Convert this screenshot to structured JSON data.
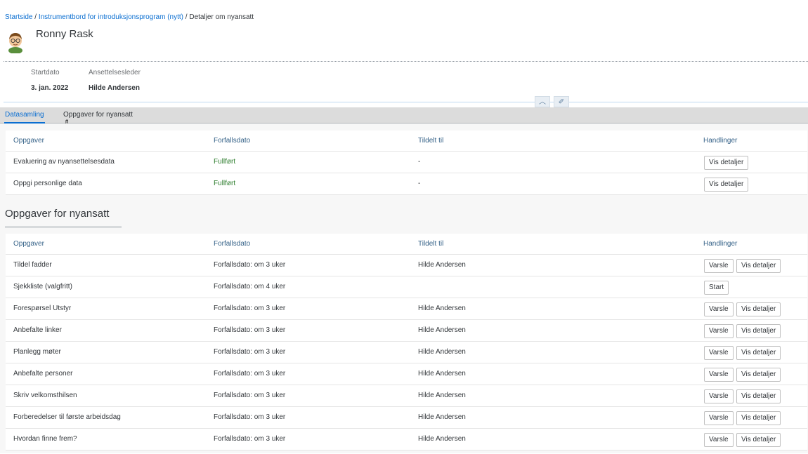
{
  "breadcrumb": {
    "home": "Startside",
    "sep1": " / ",
    "dashboard": "Instrumentbord for introduksjonsprogram (nytt)",
    "sep2": " / ",
    "current": "Detaljer om nyansatt"
  },
  "employee": {
    "name": "Ronny Rask"
  },
  "meta": {
    "start_label": "Startdato",
    "start_value": "3. jan. 2022",
    "manager_label": "Ansettelsesleder",
    "manager_value": "Hilde Andersen"
  },
  "controls": {
    "collapse_glyph": "︿",
    "pin_glyph": "✐"
  },
  "tabs": [
    {
      "label": "Datasamling"
    },
    {
      "label": "Oppgaver for nyansatt"
    }
  ],
  "datasamling": {
    "headers": [
      "Oppgaver",
      "Forfallsdato",
      "Tildelt til",
      "Handlinger"
    ],
    "rows": [
      {
        "task": "Evaluering av nyansettelsesdata",
        "due": "Fullført",
        "assigned": "-",
        "details": "Vis detaljer"
      },
      {
        "task": "Oppgi personlige data",
        "due": "Fullført",
        "assigned": "-",
        "details": "Vis detaljer"
      }
    ]
  },
  "nyansatt": {
    "title": "Oppgaver for nyansatt",
    "headers": [
      "Oppgaver",
      "Forfallsdato",
      "Tildelt til",
      "Handlinger"
    ],
    "rows": [
      {
        "task": "Tildel fadder",
        "due": "Forfallsdato: om 3 uker",
        "assigned": "Hilde Andersen",
        "notify": "Varsle",
        "details": "Vis detaljer"
      },
      {
        "task": "Sjekkliste (valgfritt)",
        "due": "Forfallsdato: om 4 uker",
        "assigned": "",
        "start": "Start"
      },
      {
        "task": "Forespørsel Utstyr",
        "due": "Forfallsdato: om 3 uker",
        "assigned": "Hilde Andersen",
        "notify": "Varsle",
        "details": "Vis detaljer"
      },
      {
        "task": "Anbefalte linker",
        "due": "Forfallsdato: om 3 uker",
        "assigned": "Hilde Andersen",
        "notify": "Varsle",
        "details": "Vis detaljer"
      },
      {
        "task": "Planlegg møter",
        "due": "Forfallsdato: om 3 uker",
        "assigned": "Hilde Andersen",
        "notify": "Varsle",
        "details": "Vis detaljer"
      },
      {
        "task": "Anbefalte personer",
        "due": "Forfallsdato: om 3 uker",
        "assigned": "Hilde Andersen",
        "notify": "Varsle",
        "details": "Vis detaljer"
      },
      {
        "task": "Skriv velkomsthilsen",
        "due": "Forfallsdato: om 3 uker",
        "assigned": "Hilde Andersen",
        "notify": "Varsle",
        "details": "Vis detaljer"
      },
      {
        "task": "Forberedelser til første arbeidsdag",
        "due": "Forfallsdato: om 3 uker",
        "assigned": "Hilde Andersen",
        "notify": "Varsle",
        "details": "Vis detaljer"
      },
      {
        "task": "Hvordan finne frem?",
        "due": "Forfallsdato: om 3 uker",
        "assigned": "Hilde Andersen",
        "notify": "Varsle",
        "details": "Vis detaljer"
      }
    ]
  },
  "colors": {
    "accent": "#0a6ed1",
    "complete": "#2b7c2b",
    "header_text": "#346187"
  }
}
